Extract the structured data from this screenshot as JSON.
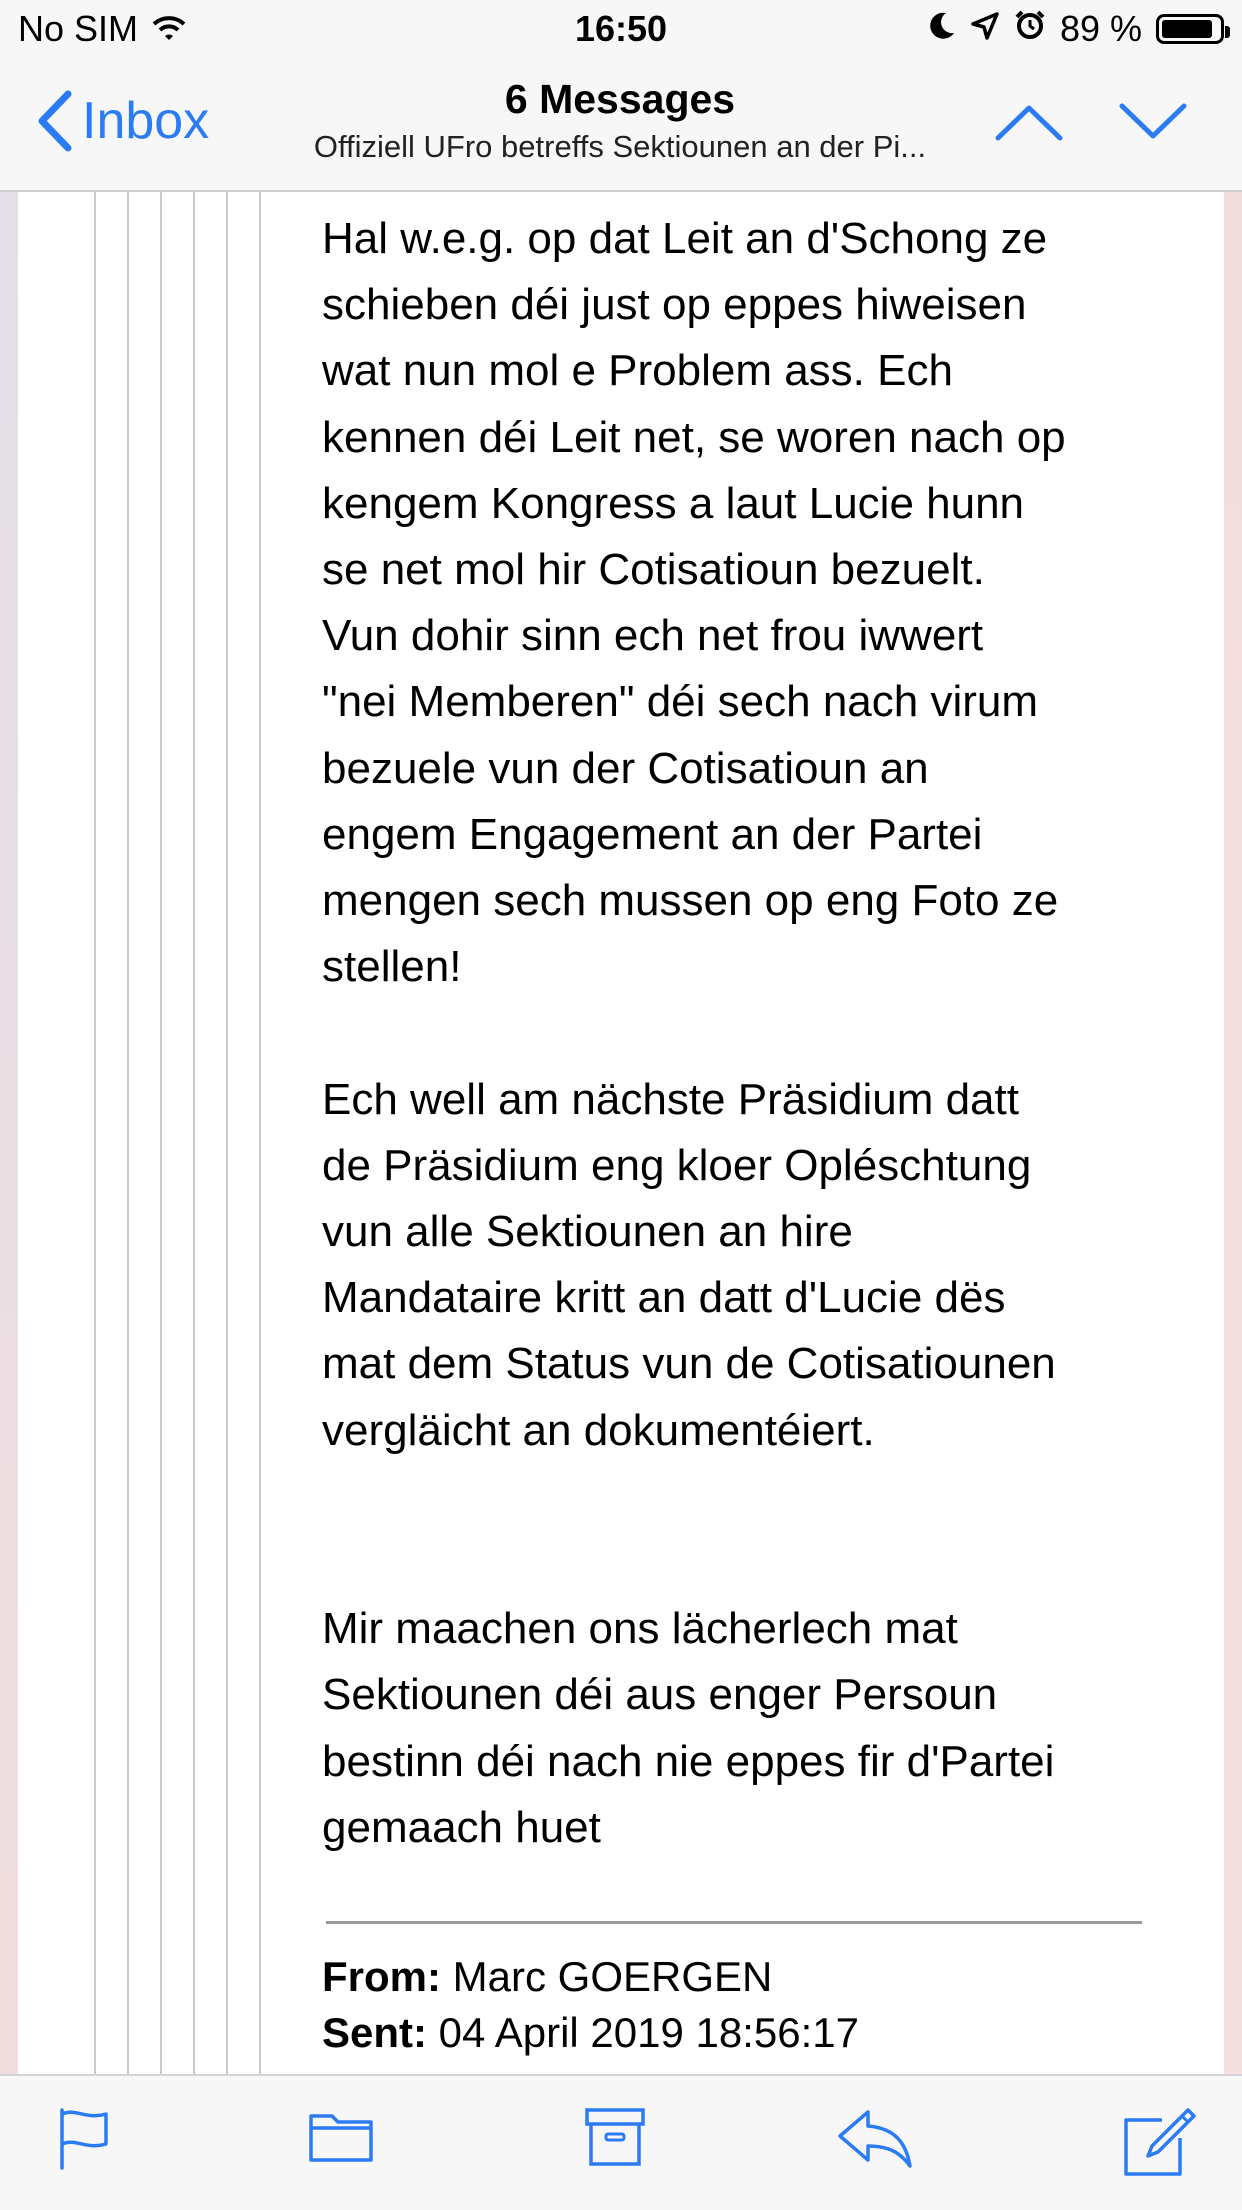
{
  "status_bar": {
    "carrier": "No SIM",
    "time": "16:50",
    "battery_text": "89 %",
    "battery_level": 0.89,
    "icons": [
      "wifi-icon",
      "moon-icon",
      "location-icon",
      "alarm-icon",
      "battery-icon"
    ]
  },
  "nav": {
    "back_label": "Inbox",
    "title": "6 Messages",
    "subtitle": "Offiziell UFro betreffs Sektiounen an der Pi..."
  },
  "message": {
    "paragraphs": [
      "Hal w.e.g. op dat Leit an d'Schong ze\nschieben déi just op eppes hiweisen\nwat nun mol e Problem ass. Ech\nkennen déi Leit net, se woren nach op\nkengem Kongress a laut Lucie hunn\nse net mol hir Cotisatioun bezuelt.\nVun dohir sinn ech net frou iwwert\n\"nei Memberen\" déi sech nach virum\nbezuele vun der Cotisatioun an\nengem Engagement an der Partei\nmengen sech mussen op eng Foto ze\nstellen!",
      "Ech well am nächste Präsidium datt\nde Präsidium eng kloer Opléschtung\nvun alle Sektiounen an hire\nMandataire kritt an datt d'Lucie dës\nmat dem Status vun de Cotisatiounen\nvergläicht an dokumentéiert.",
      "Mir maachen ons lächerlech mat\nSektiounen déi aus enger Persoun\nbestinn déi nach nie eppes fir d'Partei\ngemaach huet"
    ],
    "header_from_label": "From:",
    "header_from_value": "Marc GOERGEN",
    "header_sent_label": "Sent:",
    "header_sent_value": "04 April 2019 18:56:17"
  },
  "colors": {
    "accent": "#2b7bf5",
    "bar_bg": "#f7f7f8",
    "quote_line": "#c9c9cc"
  },
  "toolbar": {
    "icons": [
      "flag-icon",
      "folder-icon",
      "archive-icon",
      "reply-icon",
      "compose-icon"
    ]
  }
}
